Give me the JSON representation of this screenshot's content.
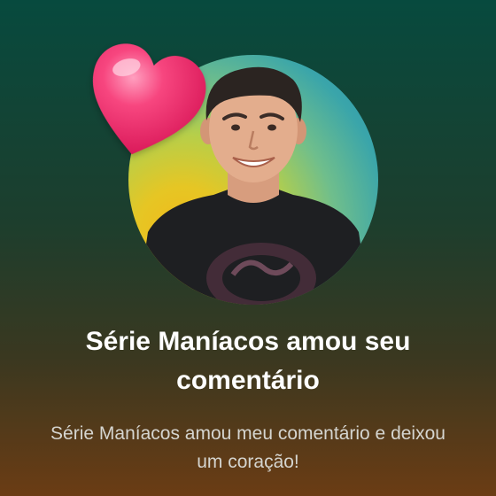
{
  "notification": {
    "title": "Série Maníacos amou seu comentário",
    "message": "Série Maníacos amou meu comentário e deixou um coração!",
    "reaction_icon": "heart-icon",
    "avatar": "profile-photo",
    "colors": {
      "background_top": "#074a3e",
      "background_bottom": "#6b3c14",
      "heart": "#f23f78",
      "title_text": "#ffffff",
      "message_text": "#d5d5d0"
    }
  }
}
